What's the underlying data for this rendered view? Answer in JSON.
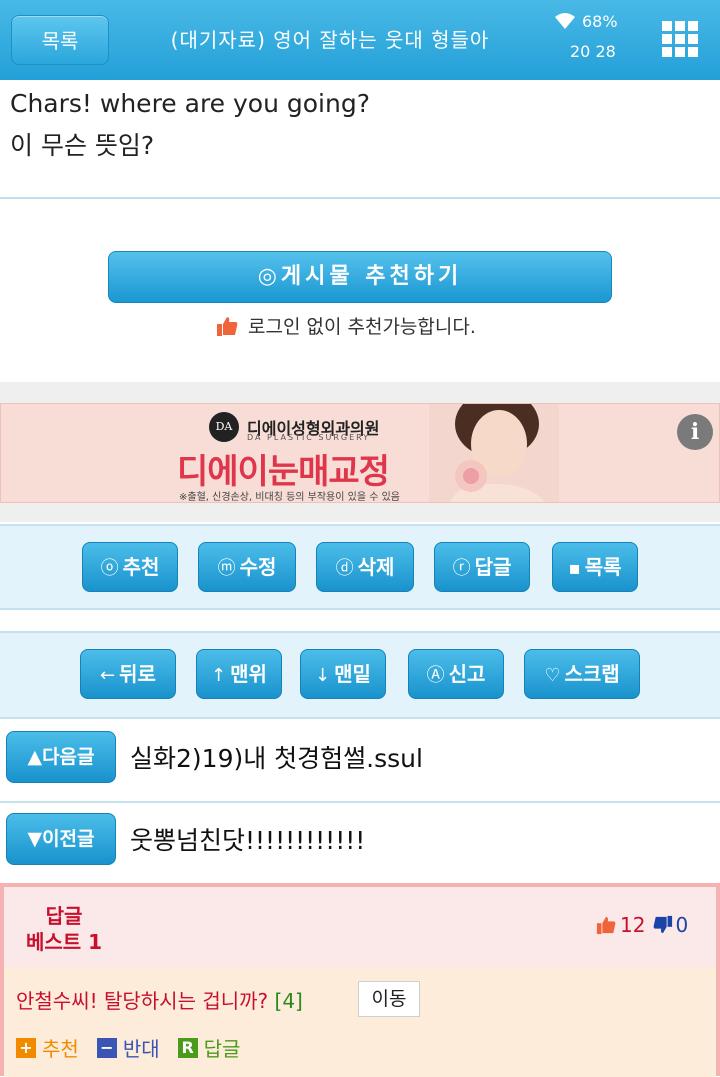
{
  "header": {
    "list_label": "목록",
    "title": "(대기자료) 영어 잘하는 웃대 형들아",
    "battery": "68%",
    "time": "20 28"
  },
  "post": {
    "lines": [
      "Chars! where are you going?",
      "이 무슨 뜻임?"
    ]
  },
  "recommend": {
    "button_label": "◎게시물 추천하기",
    "login_note": "로그인 없이 추천가능합니다."
  },
  "ad": {
    "logo": "DA",
    "clinic": "디에이성형외과의원",
    "clinic_en": "DA PLASTIC SURGERY",
    "headline": "디에이눈매교정",
    "note": "※출혈, 신경손상, 비대칭 등의 부작용이 있을 수 있음",
    "info": "i"
  },
  "actions": [
    {
      "icon": "ⓞ",
      "label": "추천"
    },
    {
      "icon": "ⓜ",
      "label": "수정"
    },
    {
      "icon": "ⓓ",
      "label": "삭제"
    },
    {
      "icon": "ⓡ",
      "label": "답글"
    },
    {
      "icon": "▪",
      "label": "목록"
    }
  ],
  "nav_actions": [
    {
      "icon": "←",
      "label": "뒤로"
    },
    {
      "icon": "↑",
      "label": "맨위"
    },
    {
      "icon": "↓",
      "label": "맨밑"
    },
    {
      "icon": "Ⓐ",
      "label": "신고"
    },
    {
      "icon": "♡",
      "label": "스크랩"
    }
  ],
  "next_post": {
    "button": "▲다음글",
    "title": "실화2)19)내 첫경험썰.ssul"
  },
  "prev_post": {
    "button": "▼이전글",
    "title": "웃뽕넘친닷!!!!!!!!!!!!"
  },
  "best_reply": {
    "label_line1": "답글",
    "label_line2": "베스트 1",
    "up_count": "12",
    "down_count": "0",
    "text": "안철수씨! 탈당하시는 겁니까?",
    "reply_count": "[4]",
    "move_label": "이동",
    "actions": [
      {
        "icon": "+",
        "label": "추천",
        "color": "#f28a00"
      },
      {
        "icon": "−",
        "label": "반대",
        "color": "#3a55b4"
      },
      {
        "icon": "R",
        "label": "답글",
        "color": "#4b9a1c"
      }
    ]
  }
}
